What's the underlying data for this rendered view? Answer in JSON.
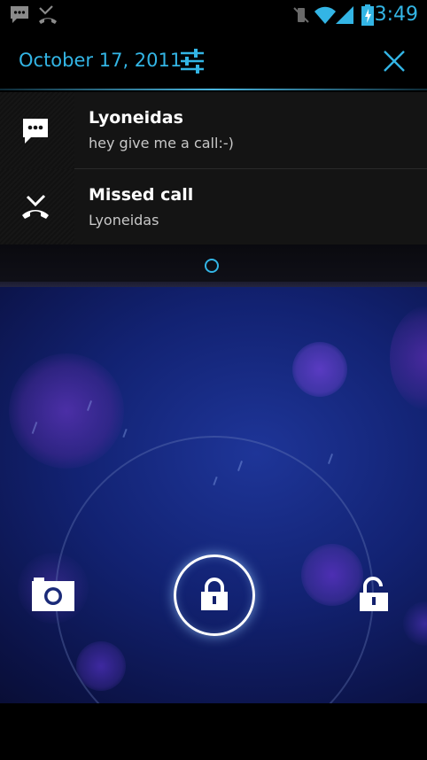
{
  "status_bar": {
    "time": "3:49",
    "icons": [
      "sms-notification-icon",
      "missed-call-icon",
      "vibrate-icon",
      "wifi-icon",
      "signal-icon",
      "battery-charging-icon"
    ],
    "accent": "#33b5e5"
  },
  "notification_panel": {
    "date": "October 17, 2011",
    "settings_icon": "settings-sliders-icon",
    "clear_icon": "close-icon"
  },
  "notifications": [
    {
      "icon": "sms-icon",
      "title": "Lyoneidas",
      "text": "hey give me a call:-)"
    },
    {
      "icon": "missed-call-icon",
      "title": "Missed call",
      "text": "Lyoneidas"
    }
  ],
  "lockscreen": {
    "left_target": "camera-icon",
    "center": "lock-icon",
    "right_target": "unlock-icon",
    "wallpaper_color": "#12217a"
  }
}
